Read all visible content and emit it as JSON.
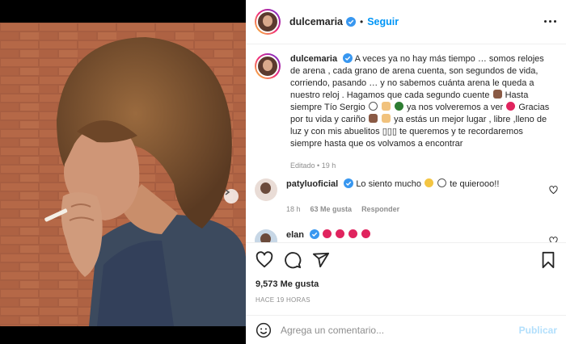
{
  "post": {
    "author": "dulcemaria",
    "follow_label": "Seguir",
    "separator": "•"
  },
  "caption": {
    "author": "dulcemaria",
    "line1": "A veces ya no hay más tiempo … somos relojes de arena , cada grano de arena cuenta, son segundos de vida, corriendo, pasando … y no sabemos cuánta arena le queda a nuestro reloj . Hagamos que cada segundo cuente",
    "line2": "Hasta siempre Tío Sergio",
    "line3": "ya nos volveremos a ver",
    "line4": "Gracias por tu vida y cariño",
    "line5": "ya estás un mejor lugar , libre ,lleno de luz y con mis abuelitos",
    "line6": "te queremos y te recordaremos siempre hasta que os volvamos a encontrar",
    "hidden_glyphs": "▯▯▯",
    "edited": "Editado",
    "age": "19 h"
  },
  "comments": [
    {
      "author": "patyluoficial",
      "text_a": "Lo siento mucho",
      "text_b": "te quierooo!!",
      "age": "18 h",
      "likes": "63 Me gusta",
      "reply": "Responder"
    },
    {
      "author": "elan"
    }
  ],
  "engagement": {
    "likes": "9,573 Me gusta",
    "timestamp": "HACE 19 HORAS"
  },
  "composer": {
    "placeholder": "Agrega un comentario...",
    "publish": "Publicar"
  },
  "colors": {
    "accent": "#0095f6",
    "publish_disabled": "#b2dffc",
    "heart": "#ed4956",
    "muted": "#8e8e8e"
  },
  "icons": [
    "verified-icon",
    "more-icon",
    "heart-icon",
    "comment-icon",
    "share-icon",
    "bookmark-icon",
    "emoji-icon",
    "next-arrow-icon"
  ]
}
